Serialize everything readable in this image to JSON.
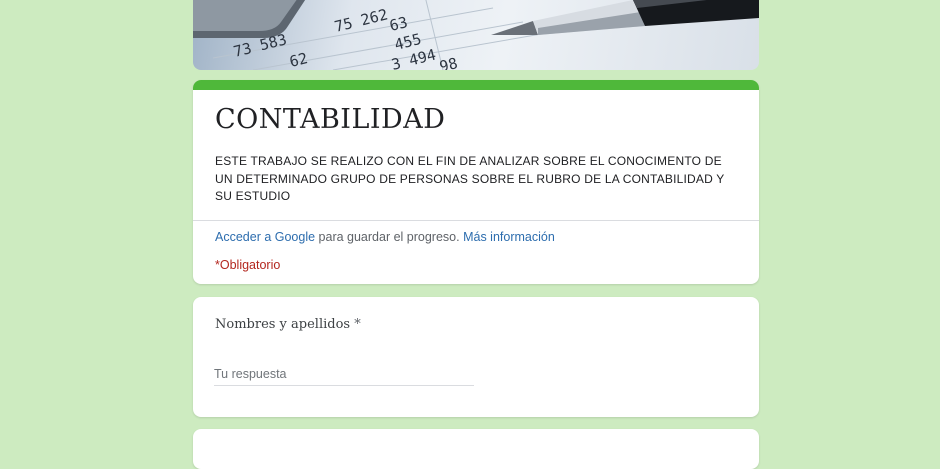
{
  "form": {
    "title": "CONTABILIDAD",
    "description": "ESTE TRABAJO SE REALIZO CON EL FIN DE ANALIZAR SOBRE EL CONOCIMENTO DE UN DETERMINADO GRUPO DE PERSONAS SOBRE EL RUBRO DE LA CONTABILIDAD Y SU ESTUDIO",
    "signin_link": "Acceder a Google",
    "signin_text": " para guardar el progreso.",
    "more_info_link": "Más información",
    "required_note": "*Obligatorio",
    "accent_color": "#4fb83a"
  },
  "banner": {
    "numbers": [
      "73 583",
      "62",
      "75 262",
      "63",
      "455",
      "3 494",
      "98"
    ],
    "icon": "pen-and-ledger-image"
  },
  "questions": [
    {
      "label": "Nombres y apellidos",
      "required_mark": "*",
      "placeholder": "Tu respuesta"
    }
  ]
}
